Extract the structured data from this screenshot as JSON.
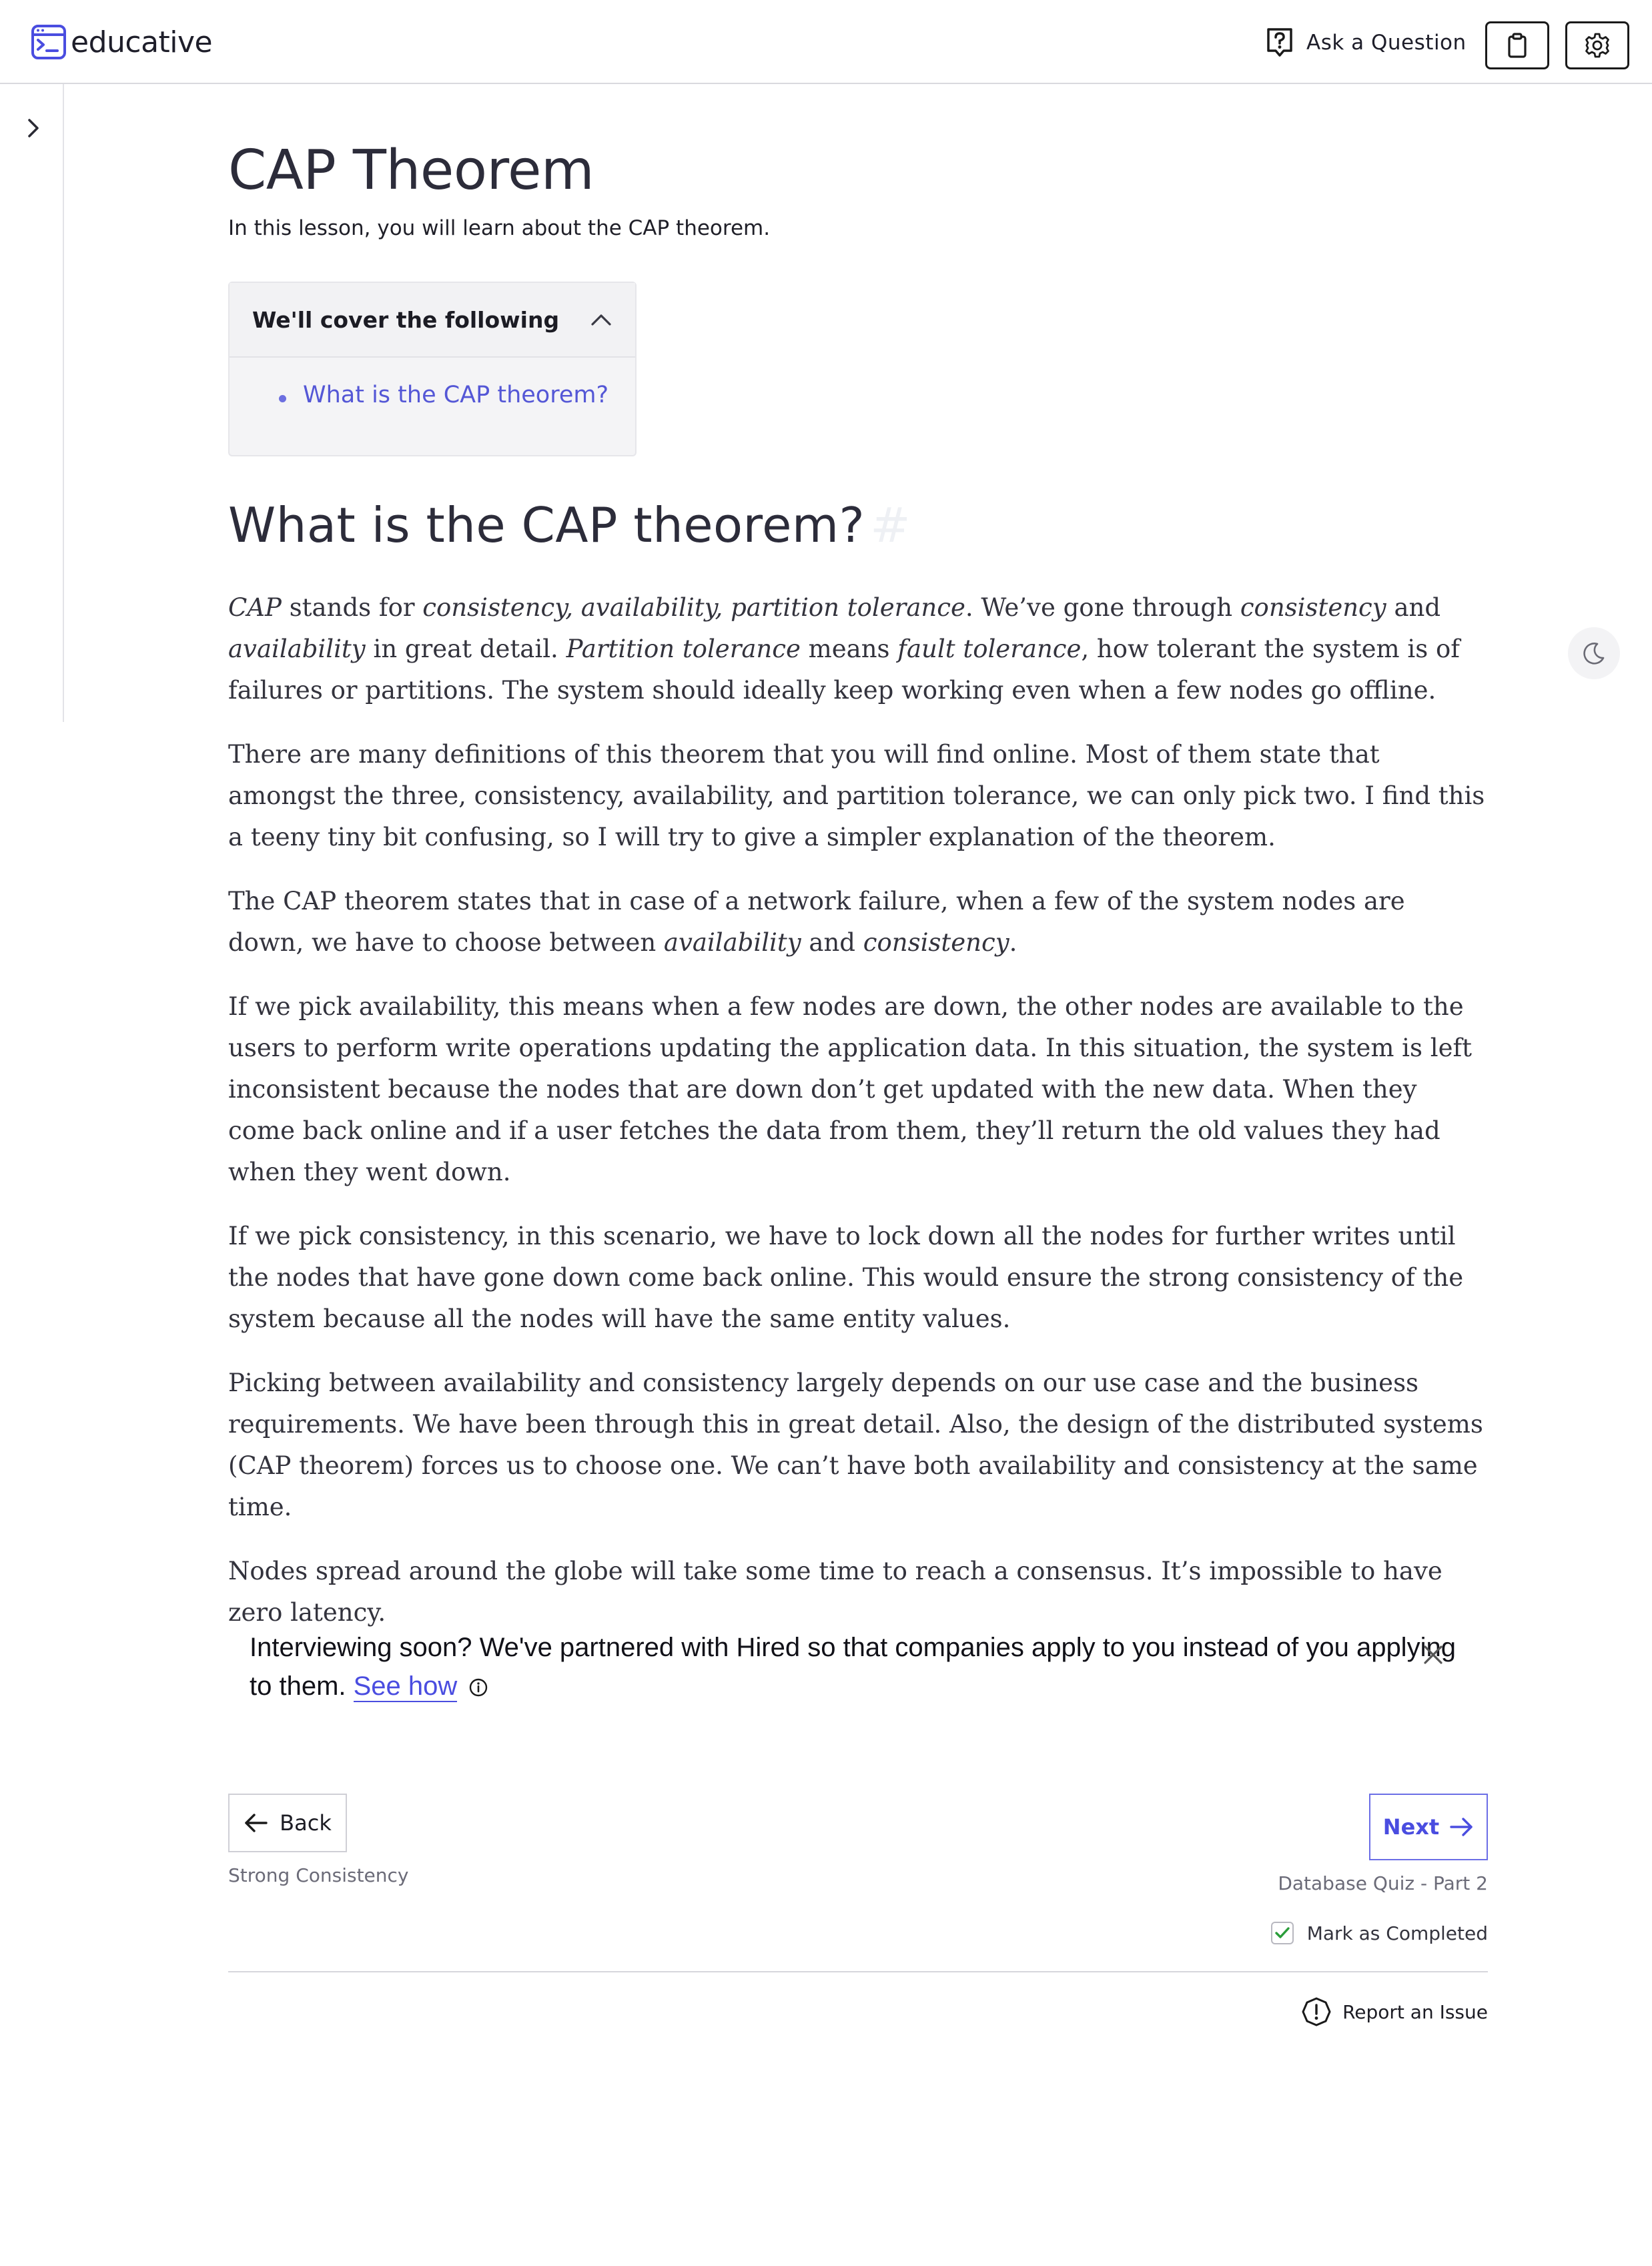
{
  "header": {
    "logo_text": "educative",
    "ask_label": "Ask a Question",
    "accent_color": "#4a4de0"
  },
  "lesson": {
    "title": "CAP Theorem",
    "subtitle": "In this lesson, you will learn about the CAP theorem."
  },
  "toc": {
    "title": "We'll cover the following",
    "items": [
      "What is the CAP theorem?"
    ]
  },
  "section": {
    "heading": "What is the CAP theorem?",
    "anchor": "#"
  },
  "paragraphs": {
    "p1": {
      "a": "CAP",
      "b": " stands for ",
      "c": "consistency, availability, partition tolerance",
      "d": ". We’ve gone through ",
      "e": "consistency",
      "f": " and ",
      "g": "availability",
      "h": " in great detail. ",
      "i": "Partition tolerance",
      "j": " means ",
      "k": "fault tolerance",
      "l": ", how tolerant the system is of failures or partitions. The system should ideally keep working even when a few nodes go offline."
    },
    "p2": "There are many definitions of this theorem that you will find online. Most of them state that amongst the three, consistency, availability, and partition tolerance, we can only pick two. I find this a teeny tiny bit confusing, so I will try to give a simpler explanation of the theorem.",
    "p3": {
      "a": "The CAP theorem states that in case of a network failure, when a few of the system nodes are down, we have to choose between ",
      "b": "availability",
      "c": " and ",
      "d": "consistency",
      "e": "."
    },
    "p4": "If we pick availability, this means when a few nodes are down, the other nodes are available to the users to perform write operations updating the application data. In this situation, the system is left inconsistent because the nodes that are down don’t get updated with the new data. When they come back online and if a user fetches the data from them, they’ll return the old values they had when they went down.",
    "p5": "If we pick consistency, in this scenario, we have to lock down all the nodes for further writes until the nodes that have gone down come back online. This would ensure the strong consistency of the system because all the nodes will have the same entity values.",
    "p6": "Picking between availability and consistency largely depends on our use case and the business requirements. We have been through this in great detail. Also, the design of the distributed systems (CAP theorem) forces us to choose one. We can’t have both availability and consistency at the same time.",
    "p7": "Nodes spread around the globe will take some time to reach a consensus. It’s impossible to have zero latency."
  },
  "promo": {
    "text": "Interviewing soon? We've partnered with Hired so that companies apply to you instead of you applying to them. ",
    "link": "See how"
  },
  "navigation": {
    "back_label": "Back",
    "prev_lesson": "Strong Consistency",
    "next_label": "Next",
    "next_lesson": "Database Quiz - Part 2",
    "mark_completed": "Mark as Completed",
    "report_issue": "Report an Issue"
  }
}
